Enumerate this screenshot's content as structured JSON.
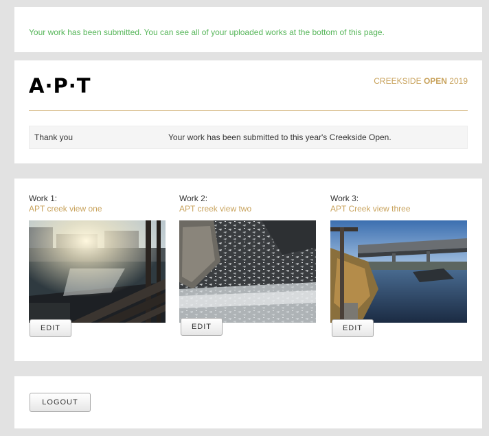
{
  "notice": {
    "text": "Your work has been submitted. You can see all of your uploaded works at the bottom of this page."
  },
  "header": {
    "logo": "A·P·T",
    "event_name": "CREEKSIDE",
    "event_strong": "OPEN",
    "event_year": "2019",
    "thanks_label": "Thank you",
    "thanks_message": "Your work has been submitted to this year's Creekside Open."
  },
  "works": [
    {
      "number_label": "Work 1:",
      "title": "APT creek view one",
      "edit_label": "EDIT"
    },
    {
      "number_label": "Work 2:",
      "title": "APT creek view two",
      "edit_label": "EDIT"
    },
    {
      "number_label": "Work 3:",
      "title": "APT Creek view three",
      "edit_label": "EDIT"
    }
  ],
  "logout": {
    "label": "LOGOUT"
  },
  "colors": {
    "accent_gold": "#c8a25b",
    "notice_green": "#57b65a",
    "page_background": "#e2e2e2"
  }
}
